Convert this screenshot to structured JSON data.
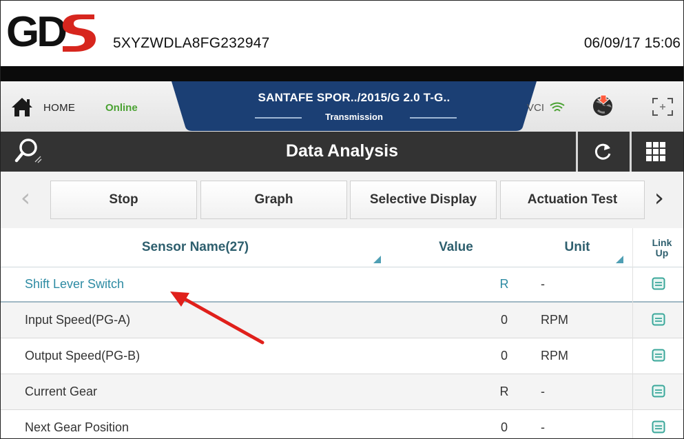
{
  "header": {
    "logo_text": "GDS",
    "vin": "5XYZWDLA8FG232947",
    "datetime": "06/09/17 15:06"
  },
  "status": {
    "home_label": "HOME",
    "online_label": "Online",
    "vehicle_title": "SANTAFE SPOR../2015/G 2.0 T-G..",
    "vehicle_subtitle": "Transmission",
    "vci_label": "VCI",
    "online_color": "#4ba233",
    "tab_color": "#1b3f74"
  },
  "titlebar": {
    "title": "Data Analysis"
  },
  "toolbar": {
    "buttons": [
      "Stop",
      "Graph",
      "Selective Display",
      "Actuation Test"
    ]
  },
  "table": {
    "columns": {
      "sensor": "Sensor Name(27)",
      "value": "Value",
      "unit": "Unit",
      "link_up": "Link Up"
    },
    "rows": [
      {
        "name": "Shift Lever Switch",
        "value": "R",
        "unit": "-"
      },
      {
        "name": "Input Speed(PG-A)",
        "value": "0",
        "unit": "RPM"
      },
      {
        "name": "Output Speed(PG-B)",
        "value": "0",
        "unit": "RPM"
      },
      {
        "name": "Current Gear",
        "value": "R",
        "unit": "-"
      },
      {
        "name": "Next Gear Position",
        "value": "0",
        "unit": "-"
      }
    ]
  },
  "accent": {
    "highlight_text": "#2d8ba3",
    "arrow": "#e0201b",
    "link_icon": "#3aa79a"
  }
}
